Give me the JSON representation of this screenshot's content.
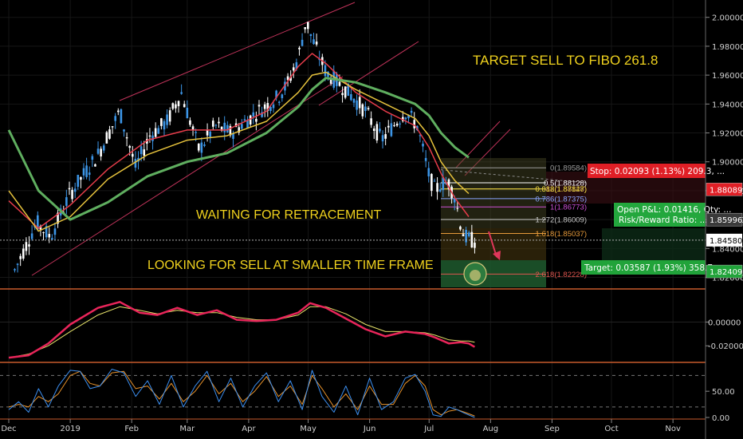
{
  "chart_data": {
    "type": "candlestick",
    "price_axis": {
      "range": [
        1.812,
        2.012
      ],
      "tick_labels": [
        "2.00000",
        "1.98000",
        "1.96000",
        "1.94000",
        "1.92000",
        "1.90000",
        "1.88000",
        "1.86000",
        "1.84000",
        "1.82000"
      ],
      "ticks": [
        2.0,
        1.98,
        1.96,
        1.94,
        1.92,
        1.9,
        1.88,
        1.86,
        1.84,
        1.82
      ]
    },
    "time_axis": {
      "labels": [
        "Dec",
        "2019",
        "Feb",
        "Mar",
        "Apr",
        "May",
        "Jun",
        "Jul",
        "Aug",
        "Sep",
        "Oct",
        "Nov"
      ],
      "label_days": [
        0,
        31,
        62,
        90,
        121,
        151,
        182,
        212,
        243,
        274,
        304,
        335
      ]
    },
    "price_series": {
      "name": "",
      "days": [
        3,
        14,
        21,
        31,
        45,
        56,
        64,
        71,
        80,
        87,
        96,
        104,
        112,
        126,
        136,
        141,
        146,
        150,
        153,
        160,
        170,
        180,
        188,
        200,
        206,
        212,
        215,
        218,
        222,
        225,
        228,
        230,
        233,
        235
      ],
      "values": [
        1.825,
        1.858,
        1.848,
        1.878,
        1.905,
        1.935,
        1.896,
        1.918,
        1.928,
        1.948,
        1.908,
        1.925,
        1.92,
        1.935,
        1.945,
        1.955,
        1.972,
        1.998,
        1.985,
        1.962,
        1.95,
        1.935,
        1.915,
        1.935,
        1.925,
        1.89,
        1.88,
        1.885,
        1.885,
        1.876,
        1.856,
        1.848,
        1.846,
        1.845
      ]
    },
    "moving_averages": [
      {
        "color": "#e63c4a",
        "days": [
          0,
          15,
          31,
          50,
          70,
          90,
          110,
          130,
          146,
          153,
          160,
          175,
          190,
          205,
          212,
          218,
          225,
          232
        ],
        "values": [
          1.873,
          1.854,
          1.87,
          1.895,
          1.915,
          1.922,
          1.922,
          1.935,
          1.966,
          1.975,
          1.968,
          1.948,
          1.935,
          1.925,
          1.91,
          1.892,
          1.875,
          1.862
        ]
      },
      {
        "color": "#e6c23c",
        "days": [
          0,
          15,
          31,
          50,
          70,
          90,
          110,
          130,
          146,
          153,
          160,
          175,
          190,
          205,
          212,
          218,
          225,
          232
        ],
        "values": [
          1.88,
          1.852,
          1.862,
          1.888,
          1.905,
          1.915,
          1.918,
          1.928,
          1.948,
          1.96,
          1.962,
          1.95,
          1.94,
          1.93,
          1.918,
          1.9,
          1.887,
          1.878
        ]
      },
      {
        "color": "#5fae5f",
        "days": [
          0,
          15,
          31,
          50,
          70,
          90,
          110,
          130,
          146,
          153,
          160,
          175,
          190,
          205,
          212,
          218,
          225,
          232
        ],
        "values": [
          1.922,
          1.88,
          1.86,
          1.872,
          1.89,
          1.9,
          1.906,
          1.92,
          1.938,
          1.95,
          1.958,
          1.955,
          1.948,
          1.94,
          1.932,
          1.92,
          1.91,
          1.903
        ]
      }
    ],
    "current_price": "1.84580",
    "price_labels": [
      {
        "text": "1.88089",
        "value": 1.88089,
        "bg": "#e01f26",
        "fg": "#ffffff"
      },
      {
        "text": "1.85996",
        "value": 1.85996,
        "bg": "#3a3a3a",
        "fg": "#ffffff"
      },
      {
        "text": "1.84580",
        "value": 1.8458,
        "bg": "#ffffff",
        "fg": "#000000"
      },
      {
        "text": "1.82409",
        "value": 1.82409,
        "bg": "#21a33a",
        "fg": "#ffffff"
      }
    ],
    "fibonacci": [
      {
        "label": "0(1.89584)",
        "value": 1.89584,
        "color": "#9a9a9a"
      },
      {
        "label": "0.382(1.88128)",
        "value": 1.88128,
        "color": "#d6b35b"
      },
      {
        "label": "0.5(1.88128)",
        "value": 1.8855,
        "color": "#ffffff"
      },
      {
        "label": "0.618(1.87847)",
        "value": 1.8812,
        "color": "#e6d23a"
      },
      {
        "label": "0.786(1.87375)",
        "value": 1.8745,
        "color": "#8aa6ff"
      },
      {
        "label": "1(1.86773)",
        "value": 1.8688,
        "color": "#cf4fd6"
      },
      {
        "label": "1.272(1.86009)",
        "value": 1.86009,
        "color": "#c9c9c9"
      },
      {
        "label": "1.618(1.85037)",
        "value": 1.85037,
        "color": "#e69a3a"
      },
      {
        "label": "2.618(1.82228)",
        "value": 1.82228,
        "color": "#e0564f"
      }
    ],
    "position": {
      "stop": "Stop: 0.02093 (1.13%) 209.3, ...",
      "open_pnl": "Open P&L: 0.01416, Qty: ...",
      "risk_reward": "Risk/Reward Ratio: ...",
      "target": "Target: 0.03587 (1.93%) 358.7, ..."
    },
    "annotations": [
      "TARGET SELL TO FIBO 261.8",
      "WAITING FOR RETRACEMENT",
      "LOOKING FOR SELL AT SMALLER TIME FRAME"
    ],
    "macd": {
      "axis_range": [
        -0.034,
        0.028
      ],
      "tick_labels": [
        "0.00000",
        "-0.02000"
      ],
      "ticks": [
        0.0,
        -0.02
      ],
      "macd_line": {
        "color": "#e8255a",
        "days": [
          0,
          10,
          20,
          31,
          45,
          56,
          66,
          75,
          85,
          95,
          105,
          115,
          125,
          135,
          146,
          152,
          160,
          170,
          180,
          190,
          200,
          210,
          215,
          222,
          228,
          232,
          235
        ],
        "values": [
          -0.03,
          -0.028,
          -0.018,
          -0.002,
          0.012,
          0.017,
          0.008,
          0.006,
          0.012,
          0.006,
          0.01,
          0.002,
          0.001,
          0.002,
          0.008,
          0.016,
          0.012,
          0.003,
          -0.006,
          -0.012,
          -0.008,
          -0.01,
          -0.013,
          -0.018,
          -0.017,
          -0.018,
          -0.021
        ]
      },
      "signal_line": {
        "color": "#e6e26a",
        "days": [
          0,
          10,
          20,
          31,
          45,
          56,
          66,
          75,
          85,
          95,
          105,
          115,
          125,
          135,
          146,
          152,
          160,
          170,
          180,
          190,
          200,
          210,
          215,
          222,
          228,
          232,
          235
        ],
        "values": [
          -0.03,
          -0.027,
          -0.02,
          -0.008,
          0.006,
          0.013,
          0.01,
          0.007,
          0.01,
          0.008,
          0.008,
          0.004,
          0.002,
          0.002,
          0.006,
          0.013,
          0.013,
          0.007,
          -0.002,
          -0.008,
          -0.008,
          -0.009,
          -0.011,
          -0.015,
          -0.016,
          -0.016,
          -0.017
        ]
      }
    },
    "stochastic": {
      "axis_range": [
        -3,
        105
      ],
      "tick_labels": [
        "50.00",
        "0.00"
      ],
      "ticks": [
        50,
        0
      ],
      "levels": [
        80,
        20
      ],
      "k_line": {
        "color": "#3c8ff0",
        "days": [
          0,
          5,
          10,
          15,
          20,
          25,
          31,
          36,
          41,
          46,
          52,
          58,
          64,
          70,
          76,
          82,
          88,
          94,
          100,
          106,
          112,
          118,
          124,
          130,
          136,
          142,
          148,
          153,
          158,
          164,
          170,
          176,
          182,
          188,
          194,
          200,
          205,
          210,
          214,
          218,
          222,
          226,
          230,
          235
        ],
        "values": [
          15,
          30,
          10,
          55,
          20,
          60,
          90,
          88,
          55,
          60,
          92,
          85,
          40,
          70,
          25,
          80,
          20,
          60,
          88,
          30,
          75,
          20,
          60,
          85,
          30,
          70,
          15,
          90,
          40,
          10,
          60,
          5,
          75,
          15,
          30,
          75,
          82,
          50,
          5,
          2,
          20,
          15,
          8,
          0
        ]
      },
      "d_line": {
        "color": "#e8922a",
        "days": [
          0,
          5,
          10,
          15,
          20,
          25,
          31,
          36,
          41,
          46,
          52,
          58,
          64,
          70,
          76,
          82,
          88,
          94,
          100,
          106,
          112,
          118,
          124,
          130,
          136,
          142,
          148,
          153,
          158,
          164,
          170,
          176,
          182,
          188,
          194,
          200,
          205,
          210,
          214,
          218,
          222,
          226,
          230,
          235
        ],
        "values": [
          20,
          25,
          20,
          40,
          30,
          45,
          80,
          88,
          65,
          60,
          85,
          88,
          55,
          60,
          35,
          65,
          30,
          50,
          80,
          45,
          65,
          30,
          50,
          78,
          40,
          60,
          25,
          80,
          55,
          20,
          45,
          15,
          60,
          25,
          25,
          65,
          80,
          60,
          15,
          5,
          12,
          15,
          10,
          3
        ]
      }
    }
  }
}
